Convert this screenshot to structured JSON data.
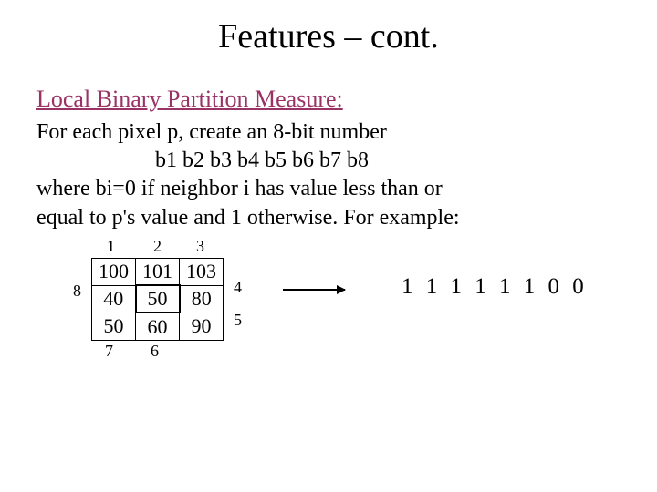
{
  "title": "Features – cont.",
  "heading": "Local Binary Partition Measure:",
  "line1": "For each pixel p, create an 8-bit number",
  "bits": "b1 b2 b3 b4 b5 b6 b7 b8",
  "line2": "where bi=0 if neighbor i has value less than or",
  "line3": "equal to p's value and  1 otherwise. For example:",
  "grid": {
    "r0c0": "100",
    "r0c1": "101",
    "r0c2": "103",
    "r1c0": "40",
    "r1c1": "50",
    "r1c2": "80",
    "r2c0": "50",
    "r2c1": "60",
    "r2c2": "90"
  },
  "labels": {
    "n1": "1",
    "n2": "2",
    "n3": "3",
    "n4": "4",
    "n5": "5",
    "n6": "6",
    "n7": "7",
    "n8": "8"
  },
  "result": "1 1 1 1 1 1 0 0"
}
